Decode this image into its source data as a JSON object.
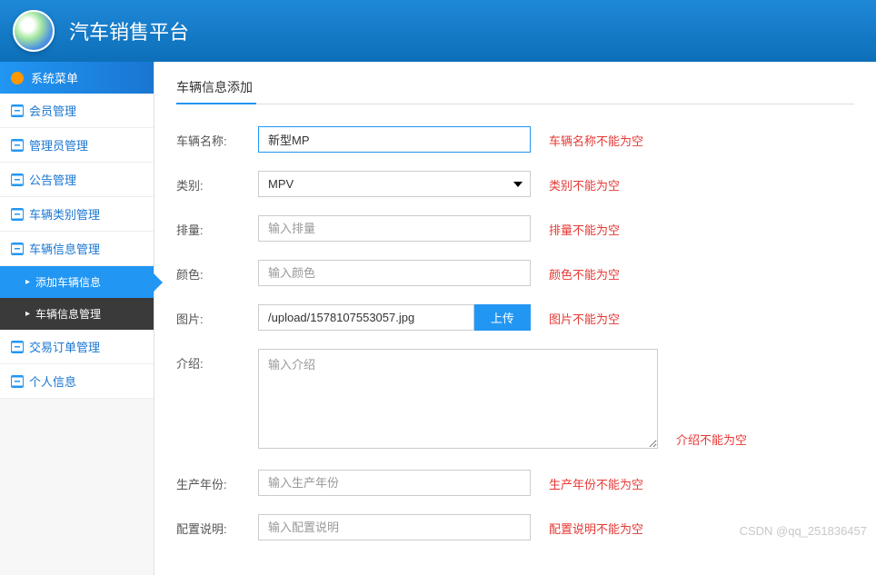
{
  "header": {
    "title": "汽车销售平台"
  },
  "sidebar": {
    "menu_header": "系统菜单",
    "items": [
      {
        "label": "会员管理"
      },
      {
        "label": "管理员管理"
      },
      {
        "label": "公告管理"
      },
      {
        "label": "车辆类别管理"
      },
      {
        "label": "车辆信息管理",
        "expanded": true
      },
      {
        "label": "交易订单管理"
      },
      {
        "label": "个人信息"
      }
    ],
    "sub_items": [
      {
        "label": "添加车辆信息",
        "active": true
      },
      {
        "label": "车辆信息管理",
        "active": false
      }
    ]
  },
  "main": {
    "page_title": "车辆信息添加",
    "form": {
      "name": {
        "label": "车辆名称:",
        "value": "新型MP",
        "error": "车辆名称不能为空"
      },
      "category": {
        "label": "类别:",
        "value": "MPV",
        "options": [
          "MPV"
        ],
        "error": "类别不能为空"
      },
      "displacement": {
        "label": "排量:",
        "placeholder": "输入排量",
        "value": "",
        "error": "排量不能为空"
      },
      "color": {
        "label": "颜色:",
        "placeholder": "输入颜色",
        "value": "",
        "error": "颜色不能为空"
      },
      "image": {
        "label": "图片:",
        "value": "/upload/1578107553057.jpg",
        "upload_btn": "上传",
        "error": "图片不能为空"
      },
      "intro": {
        "label": "介绍:",
        "placeholder": "输入介绍",
        "value": "",
        "error": "介绍不能为空"
      },
      "year": {
        "label": "生产年份:",
        "placeholder": "输入生产年份",
        "value": "",
        "error": "生产年份不能为空"
      },
      "config": {
        "label": "配置说明:",
        "placeholder": "输入配置说明",
        "value": "",
        "error": "配置说明不能为空"
      }
    }
  },
  "watermark": "CSDN @qq_251836457"
}
